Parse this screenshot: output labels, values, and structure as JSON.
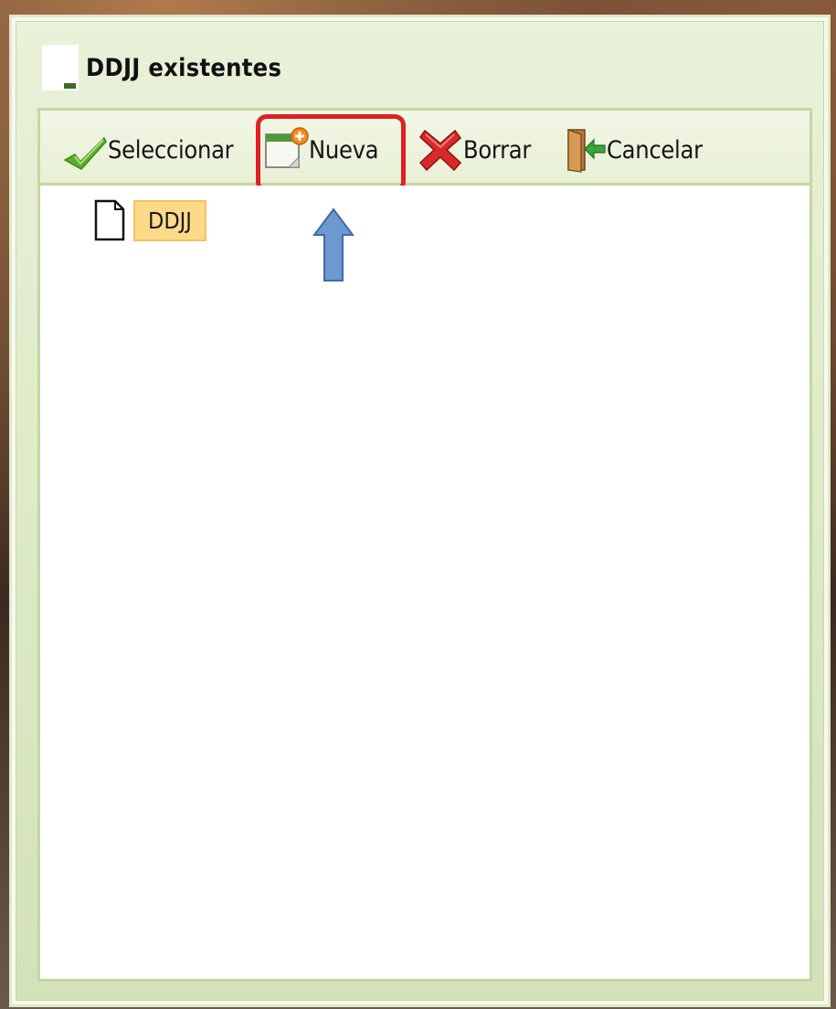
{
  "window": {
    "title": "DDJJ existentes"
  },
  "toolbar": {
    "seleccionar_label": "Seleccionar",
    "nueva_label": "Nueva",
    "borrar_label": "Borrar",
    "cancelar_label": "Cancelar"
  },
  "icons": {
    "seleccionar": "checkmark-icon",
    "nueva": "new-document-icon",
    "borrar": "red-x-icon",
    "cancelar": "exit-door-icon",
    "tree_item": "file-icon",
    "annotation": "up-arrow-icon"
  },
  "tree": {
    "items": [
      {
        "label": "DDJJ",
        "selected": true
      }
    ]
  },
  "colors": {
    "highlight_outline": "#e01f24",
    "annotation_arrow": "#6d98d0",
    "selected_item_bg": "#fdd98a",
    "panel_border": "#c6d6a3"
  }
}
